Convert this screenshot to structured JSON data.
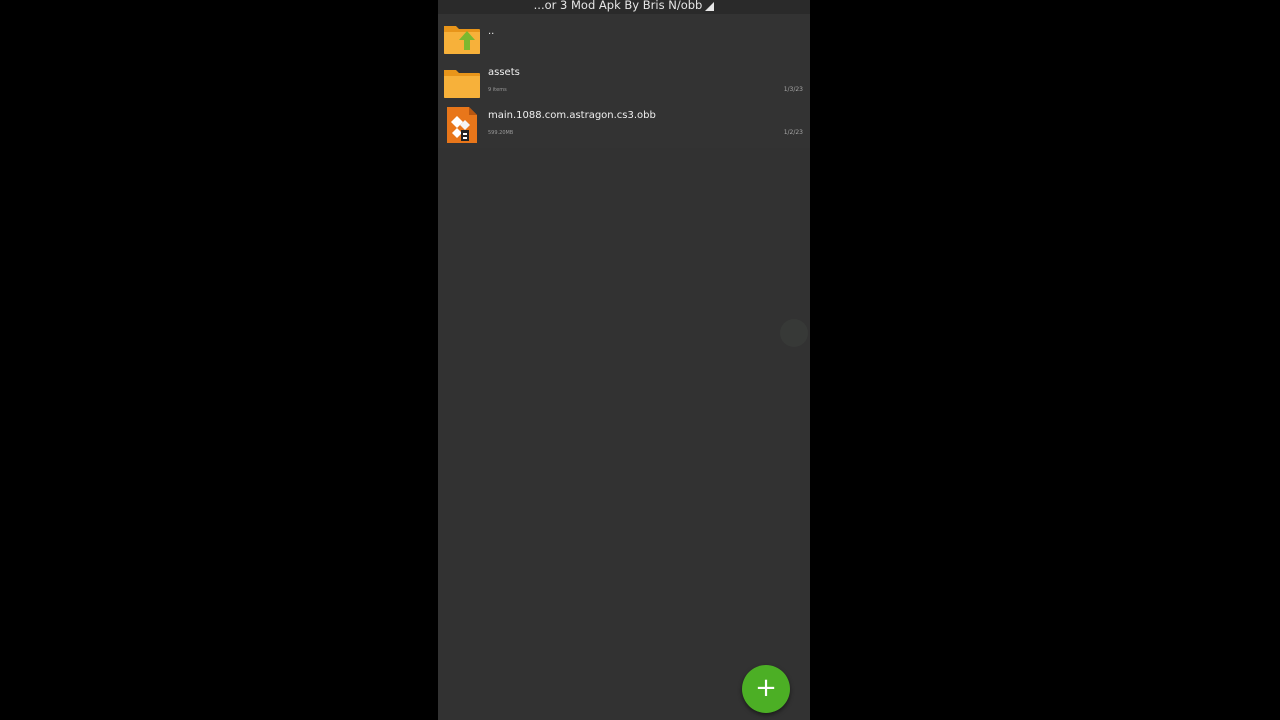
{
  "header": {
    "path": "...or 3 Mod Apk By Bris N/obb"
  },
  "files": [
    {
      "name": "..",
      "meta": "",
      "date": "",
      "icon": "folder-up-icon"
    },
    {
      "name": "assets",
      "meta": "9 items",
      "date": "1/3/23",
      "icon": "folder-icon"
    },
    {
      "name": "main.1088.com.astragon.cs3.obb",
      "meta": "599.20MB",
      "date": "1/2/23",
      "icon": "archive-file-icon"
    }
  ],
  "fab": {
    "label": "+",
    "icon": "plus-icon"
  },
  "colors": {
    "background": "#000000",
    "panel": "#323232",
    "folder": "#f5a623",
    "accent": "#4caf25",
    "up_arrow": "#8bc34a"
  }
}
